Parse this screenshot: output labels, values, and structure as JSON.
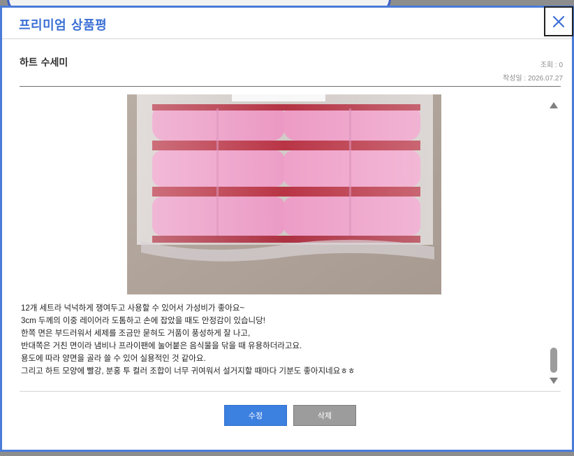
{
  "modal": {
    "title": "프리미엄 상품평",
    "close_icon": "close-icon"
  },
  "review": {
    "title": "하트 수세미",
    "views": "조회 : 0",
    "date": "작성일 : 2026.07.27",
    "image_description": "",
    "lines": [
      "12개 세트라 넉넉하게 쟁여두고 사용할 수 있어서 가성비가 좋아요~",
      "3cm 두께의 이중 레이어라 도톰하고 손에 잡았을 때도 안정감이 있습니당!",
      "한쪽 면은 부드러워서 세제를 조금만 묻혀도 거품이 풍성하게 잘 나고,",
      "반대쪽은 거친 면이라 냄비나 프라이팬에 눌어붙은 음식물을 닦을 때 유용하더라고요.",
      "용도에 따라 양면을 골라 쓸 수 있어 실용적인 것 같아요.",
      "그리고 하트 모양에 빨강, 분홍 투 컬러 조합이 너무 귀여워서 설거지할 때마다 기분도 좋아지네요ㅎㅎ"
    ]
  },
  "buttons": {
    "edit": "수정",
    "delete": "삭제"
  },
  "colors": {
    "accent": "#3b6fd4",
    "edit_button": "#3c80e0",
    "delete_button": "#9c9c9c",
    "modal_border": "#4a7bd9"
  }
}
